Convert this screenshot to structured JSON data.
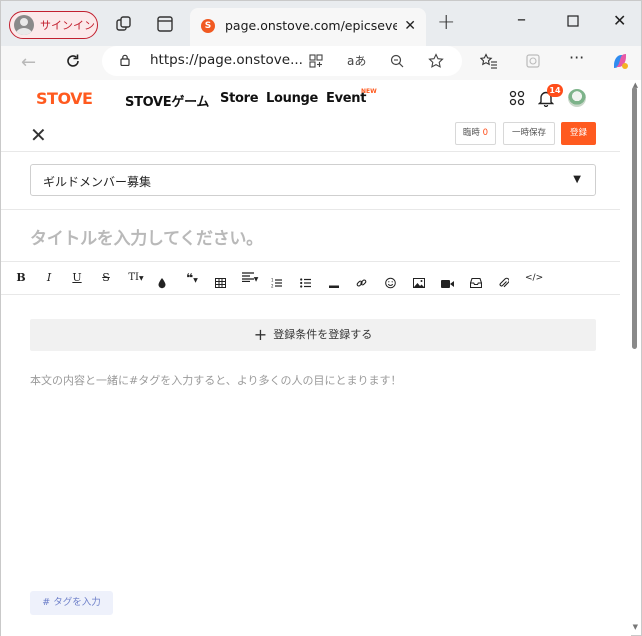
{
  "browser": {
    "signin_label": "サインイン",
    "tab_title": "page.onstove.com/epicseven/jp/",
    "url": "https://page.onstove...",
    "read_aloud_label": "aあ"
  },
  "header": {
    "logo": "STOVE",
    "nav": [
      "STOVEゲーム",
      "Store",
      "Lounge",
      "Event"
    ],
    "new_badge": "NEW",
    "notification_count": "14"
  },
  "editor": {
    "temp_label": "臨時",
    "temp_count": "0",
    "save_label": "一時保存",
    "register_label": "登録",
    "category_value": "ギルドメンバー募集",
    "title_placeholder": "タイトルを入力してください。",
    "condition_button": "登録条件を登録する",
    "body_placeholder": "本文の内容と一緒に#タグを入力すると、より多くの人の目にとまります！",
    "tag_button": "# タグを入力"
  },
  "toolbar": {
    "bold": "B",
    "italic": "I",
    "underline": "U",
    "strike": "S",
    "font_size": "TI",
    "code": "</>"
  },
  "colors": {
    "accent": "#ff5a1f",
    "signin_red": "#c2202f"
  }
}
